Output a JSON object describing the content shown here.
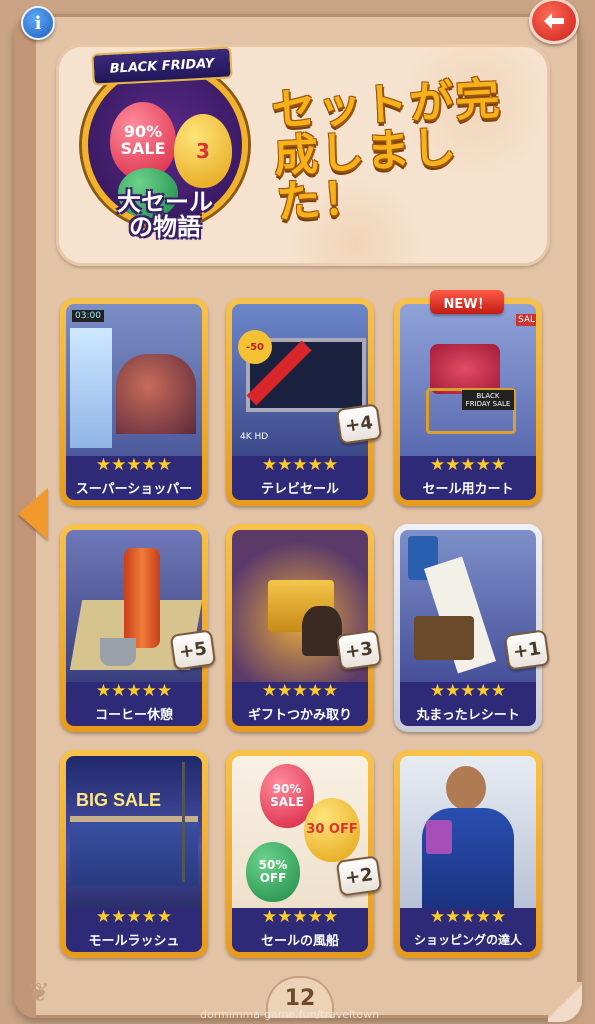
{
  "header": {
    "emblem_ribbon": "BLACK FRIDAY",
    "balloon_red": "90% SALE",
    "balloon_yellow": "3",
    "emblem_title": "大セール\nの物語",
    "complete_message": "セットが完成しました！"
  },
  "cards": [
    {
      "name": "スーパーショッパー",
      "stars": "★★★★★",
      "plus": "",
      "badge": "",
      "frame": "gold"
    },
    {
      "name": "テレビセール",
      "stars": "★★★★★",
      "plus": "+4",
      "badge": "",
      "frame": "gold"
    },
    {
      "name": "セール用カート",
      "stars": "★★★★★",
      "plus": "",
      "badge": "NEW！",
      "frame": "gold"
    },
    {
      "name": "コーヒー休憩",
      "stars": "★★★★★",
      "plus": "+5",
      "badge": "",
      "frame": "gold"
    },
    {
      "name": "ギフトつかみ取り",
      "stars": "★★★★★",
      "plus": "+3",
      "badge": "",
      "frame": "gold"
    },
    {
      "name": "丸まったレシート",
      "stars": "★★★★★",
      "plus": "+1",
      "badge": "",
      "frame": "silver"
    },
    {
      "name": "モールラッシュ",
      "stars": "★★★★★",
      "plus": "",
      "badge": "",
      "frame": "gold"
    },
    {
      "name": "セールの風船",
      "stars": "★★★★★",
      "plus": "+2",
      "badge": "",
      "frame": "gold"
    },
    {
      "name": "ショッピングの達人",
      "stars": "★★★★★",
      "plus": "",
      "badge": "",
      "frame": "gold"
    }
  ],
  "art_labels": {
    "clock": "03:00",
    "tv_sticker": "-50",
    "tv_res": "4K HD",
    "cart_sign": "BLACK FRIDAY SALE",
    "cart_sale": "SAL",
    "mall_sign": "BIG SALE",
    "balloon1": "90% SALE",
    "balloon2": "30 OFF",
    "balloon3": "50% OFF"
  },
  "footer": {
    "page_number": "12",
    "watermark": "dormimma-game.fun/traveltown"
  },
  "icons": {
    "info": "info-icon",
    "back": "back-arrow-icon",
    "prev": "left-arrow-icon",
    "leaf": "maple-leaf-icon"
  },
  "colors": {
    "card_bottom": "#2e2a78",
    "star": "#ffcc2a",
    "gold_frame": "#f8c24a",
    "title_orange": "#f7b21a",
    "back_red": "#c9201a",
    "info_blue": "#1d5fbe"
  }
}
